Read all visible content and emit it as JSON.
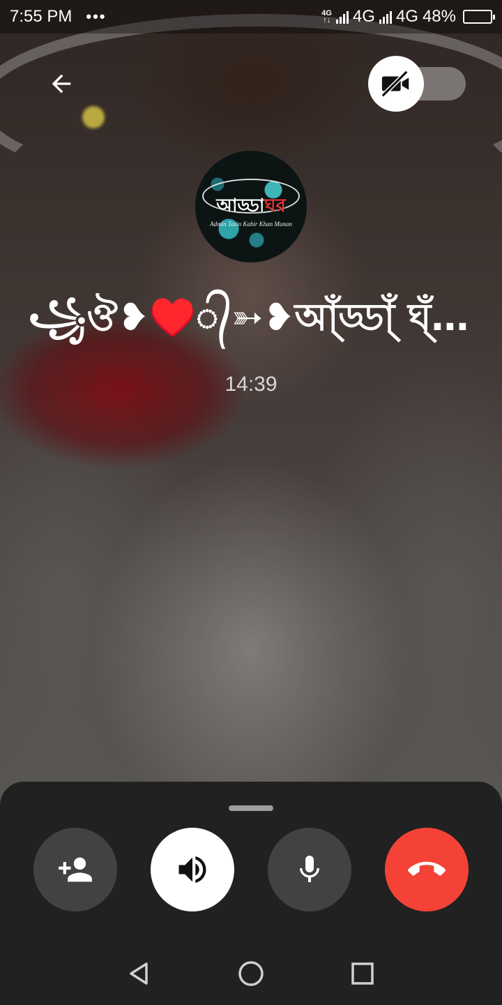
{
  "status_bar": {
    "time": "7:55 PM",
    "dots": "•••",
    "network_1": "4G",
    "network_2": "4G",
    "battery_percent_label": "48%",
    "battery_level": 0.48
  },
  "call": {
    "contact_name": "꧁ঔ❥♥️᭄➳❥আ্ঁড্ডা্ঁ ঘ্ঁর্ঁ♥️᭄➳...",
    "timer": "14:39",
    "video_enabled": false
  },
  "avatar": {
    "title_a": "আড্ডা",
    "title_b": "ঘর",
    "subtitle": "Admin Tasin Kabir Khan Munan"
  },
  "controls": {
    "icons": [
      "add-person-icon",
      "speaker-icon",
      "microphone-icon",
      "end-call-icon"
    ]
  },
  "colors": {
    "panel": "#212121",
    "end_call": "#f44336",
    "button_dark": "#424242"
  }
}
